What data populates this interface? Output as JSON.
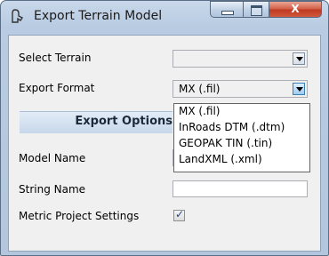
{
  "window": {
    "title": "Export Terrain Model",
    "controls": {
      "minimize_icon": "minimize-icon",
      "maximize_icon": "maximize-icon",
      "close_label": "X"
    }
  },
  "form": {
    "select_terrain": {
      "label": "Select Terrain",
      "value": ""
    },
    "export_format": {
      "label": "Export Format",
      "value": "MX (.fil)"
    },
    "section_header": "Export Options",
    "model_name": {
      "label": "Model Name",
      "value": ""
    },
    "string_name": {
      "label": "String Name",
      "value": ""
    },
    "metric": {
      "label": "Metric Project Settings",
      "checked": true,
      "check_glyph": "✓"
    }
  },
  "dropdown": {
    "options": [
      "MX (.fil)",
      "InRoads DTM (.dtm)",
      "GEOPAK TIN (.tin)",
      "LandXML (.xml)"
    ]
  },
  "colors": {
    "checkmark": "#23438d",
    "close_button": "#c03a22",
    "combo_arrow_active": "#9fcaf0"
  }
}
